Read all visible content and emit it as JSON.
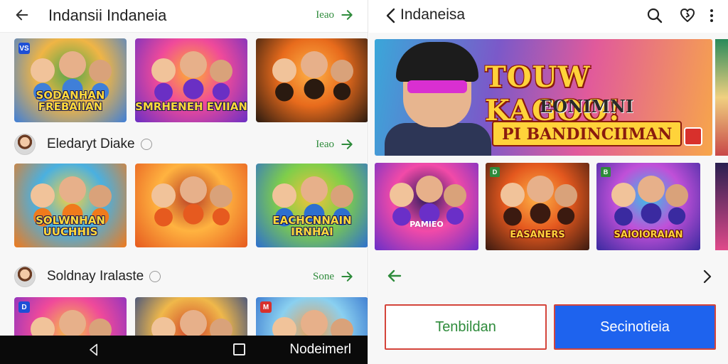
{
  "left": {
    "title": "Indansii Indaneia",
    "more_label": "Ieao",
    "row1": [
      {
        "caption": "SODANHAN FREBAIIAN",
        "badge": "VS",
        "colors": [
          "#3f7fd8",
          "#f0b545",
          "#4ea64a"
        ]
      },
      {
        "caption": "SMRHENEH EVIIAN",
        "badge": "",
        "colors": [
          "#6a2fc4",
          "#f04a9a",
          "#ffb02e"
        ]
      },
      {
        "caption": "",
        "badge": "",
        "colors": [
          "#2a1a10",
          "#e86b1c",
          "#ffb347"
        ]
      }
    ],
    "section2": {
      "title": "Eledaryt Diake",
      "more_label": "Ieao"
    },
    "row2": [
      {
        "caption": "SOLWNHAN UUCHHIS",
        "badge": "",
        "colors": [
          "#f07a1c",
          "#4ab0e0",
          "#f5d142"
        ]
      },
      {
        "caption": "",
        "badge": "",
        "colors": [
          "#e65a1f",
          "#ffb340",
          "#b83c24"
        ]
      },
      {
        "caption": "EACHCNNAIN IRNHAI",
        "badge": "",
        "colors": [
          "#2d6fcf",
          "#7fce4a",
          "#f3c23a"
        ]
      }
    ],
    "section3": {
      "title": "Soldnay Iralaste",
      "more_label": "Sone"
    },
    "row3": [
      {
        "caption": "",
        "badge": "D",
        "colors": [
          "#7a2fc8",
          "#f04a9a",
          "#f5c742"
        ]
      },
      {
        "caption": "",
        "badge": "",
        "colors": [
          "#1e3d8a",
          "#f0b84a",
          "#d0442a"
        ]
      },
      {
        "caption": "",
        "badge": "M",
        "colors": [
          "#2a66c8",
          "#8ad0f0",
          "#f0a050"
        ]
      }
    ],
    "nav_label": "Nodeimerl"
  },
  "right": {
    "title": "Indaneisa",
    "banner": {
      "title": "TOUW KAGOO!",
      "subtitle": "EONIMNI",
      "plaque": "PI BANDINCIIMAN"
    },
    "tiles": [
      {
        "caption": "PAMIEO",
        "badge": "",
        "colors": [
          "#6a2fc8",
          "#f24aa8",
          "#2c1a5c"
        ]
      },
      {
        "caption": "EASANERS",
        "badge": "D",
        "colors": [
          "#3b1a10",
          "#e4581e",
          "#ffb347"
        ]
      },
      {
        "caption": "SAIOIORAIAN",
        "badge": "B",
        "colors": [
          "#3a2aa0",
          "#c050d8",
          "#3ac0e8"
        ]
      }
    ],
    "buttons": {
      "secondary": "Tenbildan",
      "primary": "Secinotieia"
    }
  },
  "colors": {
    "accent_green": "#2e8b3b",
    "primary_blue": "#1e63ee",
    "outline_red": "#d4443b"
  }
}
